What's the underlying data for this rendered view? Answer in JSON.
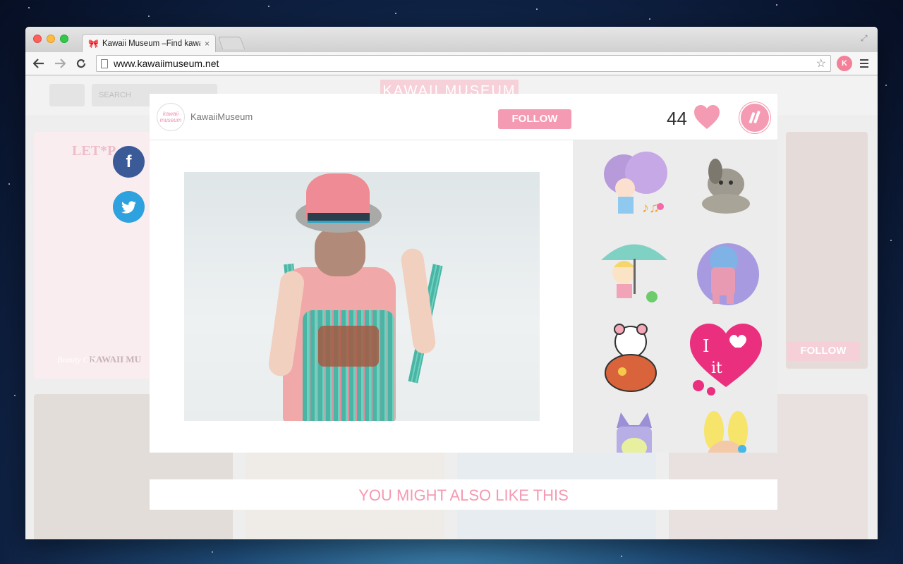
{
  "browser": {
    "tab_title": "Kawaii Museum –Find kawaii",
    "tab_close": "×",
    "url": "www.kawaiimuseum.net",
    "ext_label": "K"
  },
  "site": {
    "search_placeholder": "SEARCH",
    "logo": "KAWAII MUSEUM",
    "bg_follow": "FOLLOW",
    "bg_caption": "KAWAII MU",
    "bg_caption_2": "Beauty City",
    "bg_banner_text": "LET*P"
  },
  "modal": {
    "avatar_top": "kawaii",
    "avatar_bottom": "museum",
    "username": "KawaiiMuseum",
    "follow_label": "FOLLOW",
    "like_count": "44"
  },
  "also_like": "YOU MIGHT ALSO LIKE THIS",
  "sticker_texts": {
    "i_love_it_1": "I",
    "i_love_it_2": "it"
  },
  "colors": {
    "accent": "#f49ab2",
    "facebook": "#3a5a98",
    "twitter": "#2ea1df"
  },
  "icons": {
    "facebook": "f",
    "twitter": "t"
  }
}
